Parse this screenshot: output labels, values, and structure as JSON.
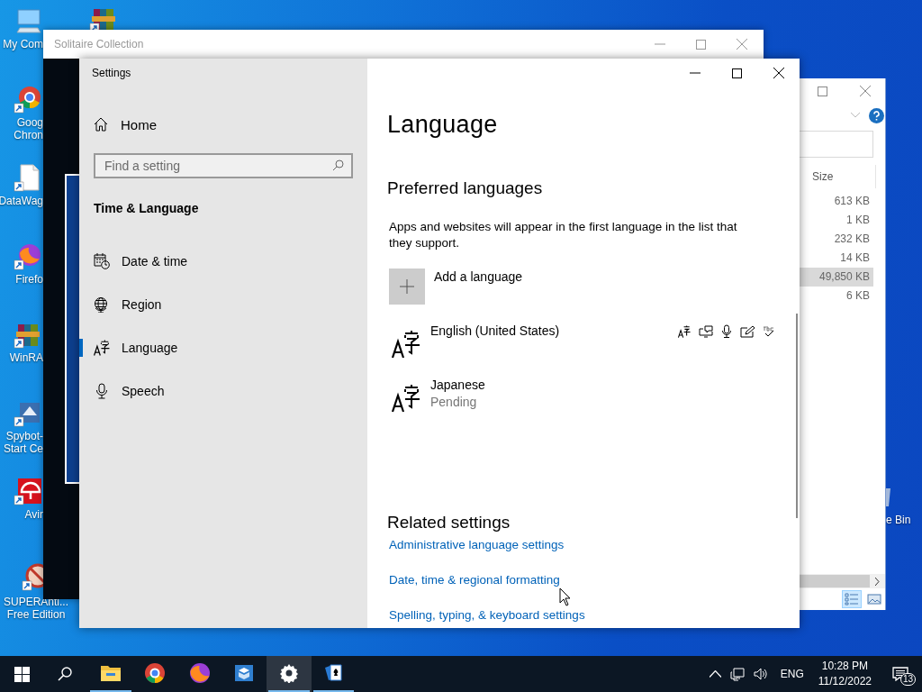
{
  "desktop_icons": [
    {
      "kind": "computer",
      "label": "My Com"
    },
    {
      "kind": "chrome",
      "label": "Goog\nChron"
    },
    {
      "kind": "file",
      "label": "DataWag"
    },
    {
      "kind": "firefox",
      "label": "Firefo"
    },
    {
      "kind": "winrar",
      "label": "WinRA"
    },
    {
      "kind": "spybot",
      "label": "Spybot-\nStart Ce"
    },
    {
      "kind": "avira",
      "label": "Avir"
    },
    {
      "kind": "superanti",
      "label": "SUPERAnti...\nFree Edition"
    }
  ],
  "desktop_corner_icon": {
    "kind": "winrar"
  },
  "recycle_bin": {
    "label": "e Bin"
  },
  "solitaire_window": {
    "title": "Solitaire Collection"
  },
  "explorer_window": {
    "column_header": "Size",
    "rows": [
      {
        "size": "613 KB",
        "selected": false
      },
      {
        "size": "1 KB",
        "selected": false
      },
      {
        "size": "232 KB",
        "selected": false
      },
      {
        "size": "14 KB",
        "selected": false
      },
      {
        "size": "49,850 KB",
        "selected": true
      },
      {
        "size": "6 KB",
        "selected": false
      }
    ]
  },
  "settings_window": {
    "title": "Settings",
    "sidebar": {
      "home": "Home",
      "search": {
        "placeholder": "Find a setting"
      },
      "section": "Time & Language",
      "items": [
        {
          "kind": "calendar",
          "label": "Date & time",
          "selected": false
        },
        {
          "kind": "globe",
          "label": "Region",
          "selected": false
        },
        {
          "kind": "language",
          "label": "Language",
          "selected": true
        },
        {
          "kind": "microphone",
          "label": "Speech",
          "selected": false
        }
      ]
    },
    "content": {
      "heading": "Language",
      "subheading": "Preferred languages",
      "description": "Apps and websites will appear in the first language in the list that they support.",
      "add_button": "Add a language",
      "languages": [
        {
          "name": "English (United States)",
          "has_features": true
        },
        {
          "name": "Japanese",
          "status": "Pending",
          "has_features": false
        }
      ],
      "related_heading": "Related settings",
      "links": [
        "Administrative language settings",
        "Date, time & regional formatting",
        "Spelling, typing, & keyboard settings"
      ]
    }
  },
  "taskbar": {
    "apps": [
      {
        "kind": "explorer",
        "running": true,
        "selected": false
      },
      {
        "kind": "chrome",
        "running": false,
        "selected": false
      },
      {
        "kind": "firefox",
        "running": false,
        "selected": false
      },
      {
        "kind": "sandbox",
        "running": false,
        "selected": false
      },
      {
        "kind": "settings",
        "running": true,
        "selected": true
      },
      {
        "kind": "solitaire",
        "running": true,
        "selected": false
      }
    ],
    "language": "ENG",
    "time": "10:28 PM",
    "date": "11/12/2022",
    "notification_count": "13"
  }
}
